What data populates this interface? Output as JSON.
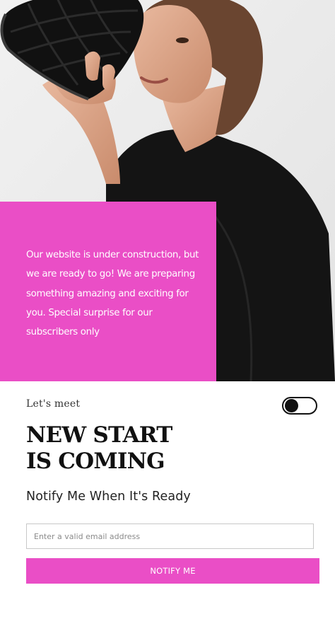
{
  "hero": {
    "image": "woman-holding-black-quilted-bag-photo"
  },
  "promo": {
    "text": "Our website is under construction, but we are ready to go! We are preparing something amazing and exciting for you. Special surprise for our subscribers only"
  },
  "intro": {
    "eyebrow": "Let's meet",
    "headline_line1": "NEW START",
    "headline_line2": "IS COMING"
  },
  "toggle": {
    "state": "off"
  },
  "notify": {
    "heading": "Notify Me When It's Ready",
    "email_placeholder": "Enter a valid email address",
    "email_value": "",
    "button_label": "NOTIFY ME"
  },
  "colors": {
    "accent": "#ea4ec6",
    "text_dark": "#111111",
    "background": "#ffffff"
  }
}
